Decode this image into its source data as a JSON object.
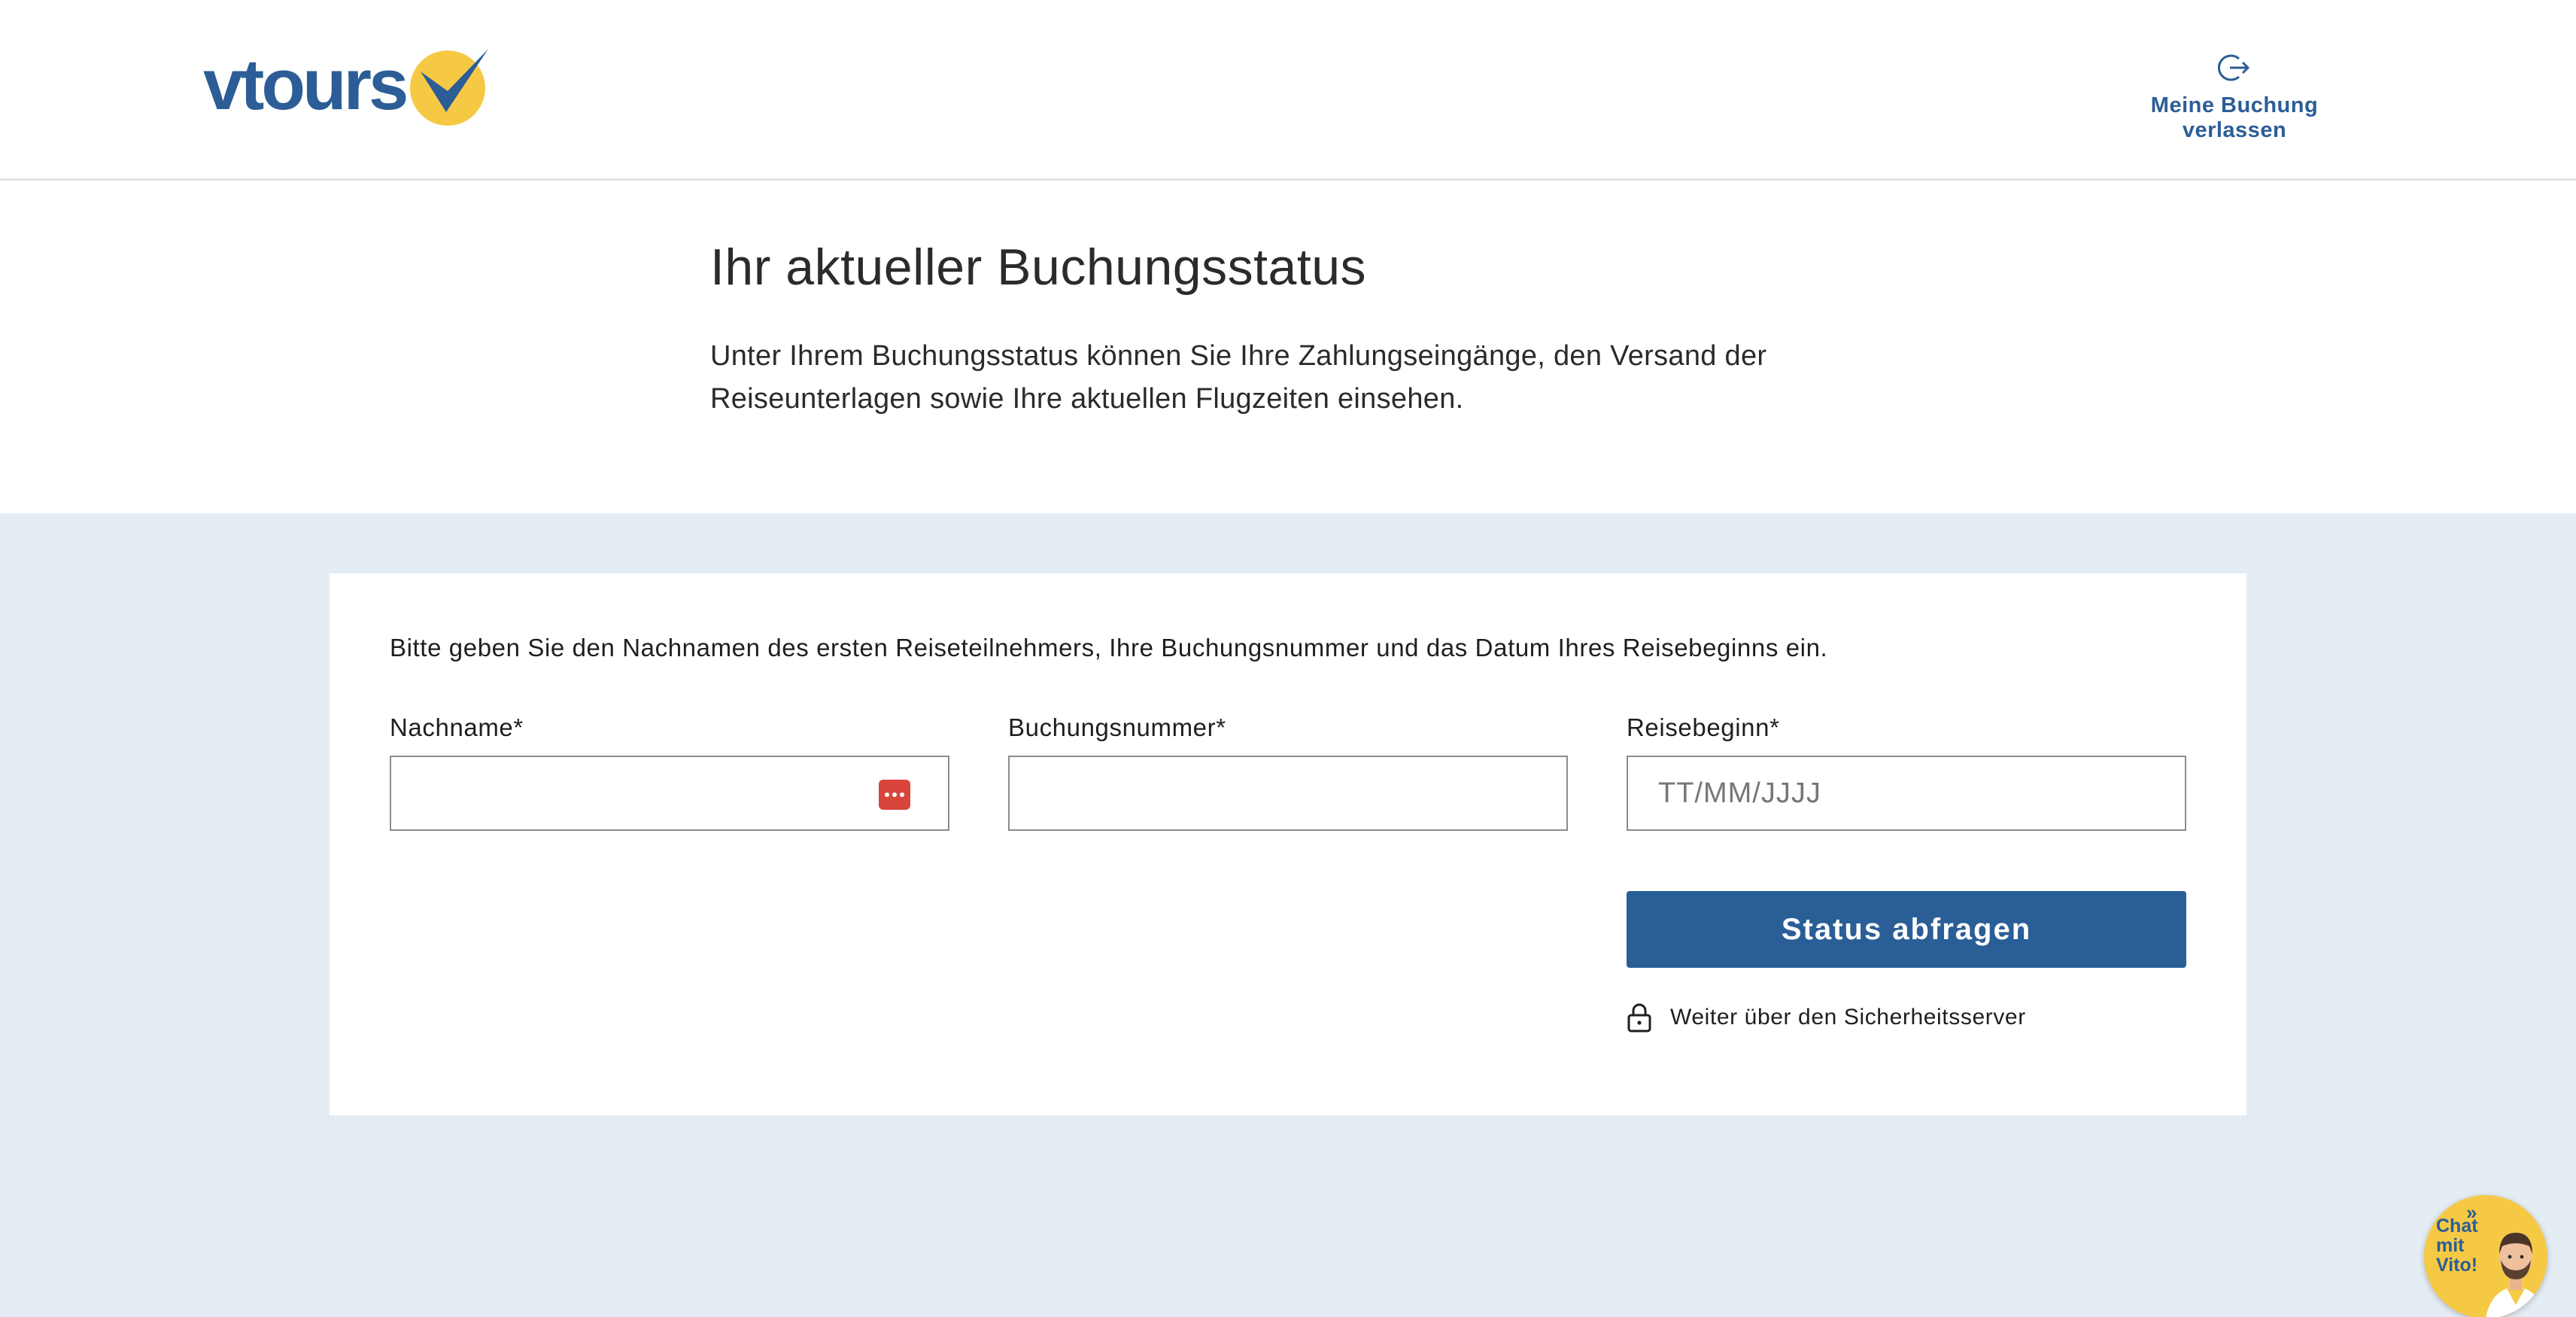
{
  "header": {
    "logo_text": "vtours",
    "leave_label": "Meine Buchung verlassen"
  },
  "intro": {
    "title": "Ihr aktueller Buchungsstatus",
    "text": "Unter Ihrem Buchungsstatus können Sie Ihre Zahlungseingänge, den Versand der Reiseunterlagen sowie Ihre aktuellen Flugzeiten einsehen."
  },
  "form": {
    "instruction": "Bitte geben Sie den Nachnamen des ersten Reiseteilnehmers, Ihre Buchungsnummer und das Datum Ihres Reisebeginns ein.",
    "fields": [
      {
        "label": "Nachname*",
        "value": "",
        "placeholder": ""
      },
      {
        "label": "Buchungsnummer*",
        "value": "",
        "placeholder": ""
      },
      {
        "label": "Reisebeginn*",
        "value": "",
        "placeholder": "TT/MM/JJJJ"
      }
    ],
    "submit_label": "Status abfragen",
    "secure_label": "Weiter über den Sicherheitsserver"
  },
  "chat": {
    "arrow": "»",
    "label_line1": "Chat",
    "label_line2": "mit",
    "label_line3": "Vito!"
  },
  "colors": {
    "brand_blue": "#2c5d96",
    "brand_yellow": "#f6c945",
    "button": "#2a5e97",
    "form_background": "#e5edf4",
    "password_manager_icon": "#d9453a"
  },
  "icons": {
    "leave": "logout-icon",
    "password_manager": "password-manager-icon",
    "secure": "lock-icon",
    "chat_avatar": "vito-avatar-icon"
  }
}
